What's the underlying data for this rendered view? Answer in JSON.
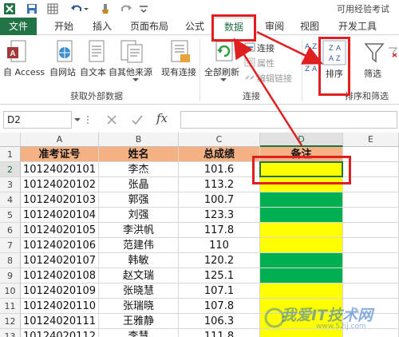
{
  "window": {
    "title": "可用经验考试"
  },
  "ribbon": {
    "tabs": [
      {
        "label": "文件"
      },
      {
        "label": "开始"
      },
      {
        "label": "插入"
      },
      {
        "label": "页面布局"
      },
      {
        "label": "公式"
      },
      {
        "label": "数据"
      },
      {
        "label": "审阅"
      },
      {
        "label": "视图"
      },
      {
        "label": "开发工具"
      }
    ],
    "active_tab": "数据",
    "groups": {
      "external": {
        "label": "获取外部数据",
        "access": "自 Access",
        "web": "自网站",
        "text": "自文本",
        "other": "自其他来源",
        "existing": "现有连接"
      },
      "connections": {
        "label": "连接",
        "refresh_all": "全部刷新",
        "connections": "连接",
        "properties": "属性",
        "edit_links": "编辑链接"
      },
      "sort_filter": {
        "label": "排序和筛选",
        "sort": "排序",
        "filter": "筛选",
        "az": "A Z",
        "za": "Z A"
      }
    }
  },
  "formula_bar": {
    "name_box": "D2",
    "fx": "fx",
    "formula": ""
  },
  "grid": {
    "columns": [
      "A",
      "B",
      "C",
      "D",
      "E"
    ],
    "selected_column": "D",
    "selected_cell": "D2",
    "header_row": [
      "准考证号",
      "姓名",
      "总成绩",
      "备注"
    ],
    "rows": [
      {
        "num": "1"
      },
      {
        "num": "2",
        "id": "10124020101",
        "name": "李杰",
        "score": "101.6",
        "fill": "yellow"
      },
      {
        "num": "3",
        "id": "10124020102",
        "name": "张晶",
        "score": "113.2",
        "fill": "yellow"
      },
      {
        "num": "4",
        "id": "10124020103",
        "name": "郭强",
        "score": "100.7",
        "fill": "green"
      },
      {
        "num": "5",
        "id": "10124020104",
        "name": "刘强",
        "score": "123.3",
        "fill": "green"
      },
      {
        "num": "6",
        "id": "10124020105",
        "name": "李洪帆",
        "score": "117.8",
        "fill": "yellow"
      },
      {
        "num": "7",
        "id": "10124020106",
        "name": "范建伟",
        "score": "110",
        "fill": "yellow"
      },
      {
        "num": "8",
        "id": "10124020107",
        "name": "韩敏",
        "score": "120.2",
        "fill": "green"
      },
      {
        "num": "9",
        "id": "10124020108",
        "name": "赵文瑞",
        "score": "125.1",
        "fill": "green"
      },
      {
        "num": "10",
        "id": "10124020109",
        "name": "张晓慧",
        "score": "107.1",
        "fill": "yellow"
      },
      {
        "num": "11",
        "id": "10124020110",
        "name": "张瑞晓",
        "score": "107.8",
        "fill": "yellow"
      },
      {
        "num": "12",
        "id": "10124020111",
        "name": "王雅静",
        "score": "106.3",
        "fill": "yellow"
      },
      {
        "num": "13",
        "id": "10124020112",
        "name": "李慧",
        "score": "111.8",
        "fill": "yellow"
      }
    ]
  },
  "watermark": {
    "text": "我爱IT技术网",
    "url": "www.52ij.com"
  },
  "colors": {
    "excel_green": "#217346",
    "header_fill": "#f4b183",
    "yellow": "#ffff00",
    "green": "#00b050",
    "callout_red": "#e02020"
  }
}
